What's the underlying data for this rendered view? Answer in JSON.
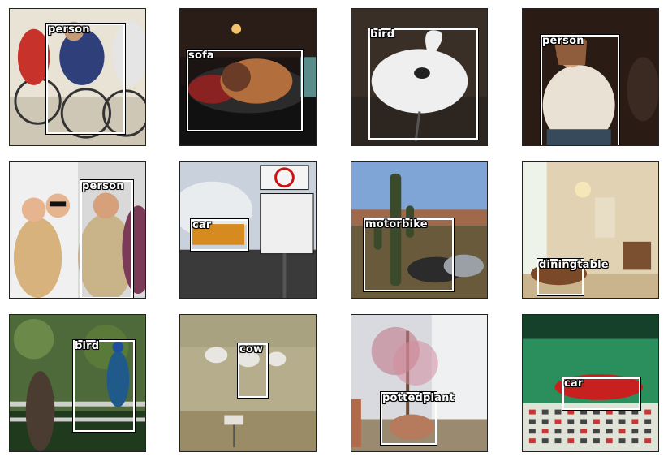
{
  "panels": [
    {
      "label": "person",
      "scene": "cycling race",
      "palette": [
        "#e9e3d6",
        "#5f5a55",
        "#c59a74"
      ]
    },
    {
      "label": "sofa",
      "scene": "dog sleeping on a sofa",
      "palette": [
        "#1b1412",
        "#6a3b26",
        "#b26f3d"
      ]
    },
    {
      "label": "bird",
      "scene": "white swan",
      "palette": [
        "#3a2f27",
        "#efefef",
        "#6c5c50"
      ]
    },
    {
      "label": "person",
      "scene": "woman in white jacket",
      "palette": [
        "#2a1b14",
        "#e9e2d4",
        "#8f5c3c"
      ]
    },
    {
      "label": "person",
      "scene": "party costumes",
      "palette": [
        "#f0f0f0",
        "#7b3b58",
        "#d7b27d"
      ]
    },
    {
      "label": "car",
      "scene": "road sign in snow",
      "palette": [
        "#c9d2dc",
        "#2c2c2c",
        "#d68a20"
      ]
    },
    {
      "label": "motorbike",
      "scene": "desert cactus and motorbikes",
      "palette": [
        "#7fa4d6",
        "#6a5a3c",
        "#3a4a2a"
      ]
    },
    {
      "label": "diningtable",
      "scene": "living room",
      "palette": [
        "#e1d2b4",
        "#7a4a28",
        "#c8b288"
      ]
    },
    {
      "label": "bird",
      "scene": "peacocks",
      "palette": [
        "#1f3a1c",
        "#4f6a3a",
        "#1f5a8a"
      ]
    },
    {
      "label": "cow",
      "scene": "cows in field",
      "palette": [
        "#b6ad8d",
        "#7c6e4a",
        "#e8e6e0"
      ]
    },
    {
      "label": "pottedplant",
      "scene": "potted tree by house",
      "palette": [
        "#d8dadf",
        "#b67a5c",
        "#5a4436"
      ]
    },
    {
      "label": "car",
      "scene": "red car in control room",
      "palette": [
        "#2a8f5c",
        "#c81f1f",
        "#dfe3d8"
      ]
    }
  ]
}
